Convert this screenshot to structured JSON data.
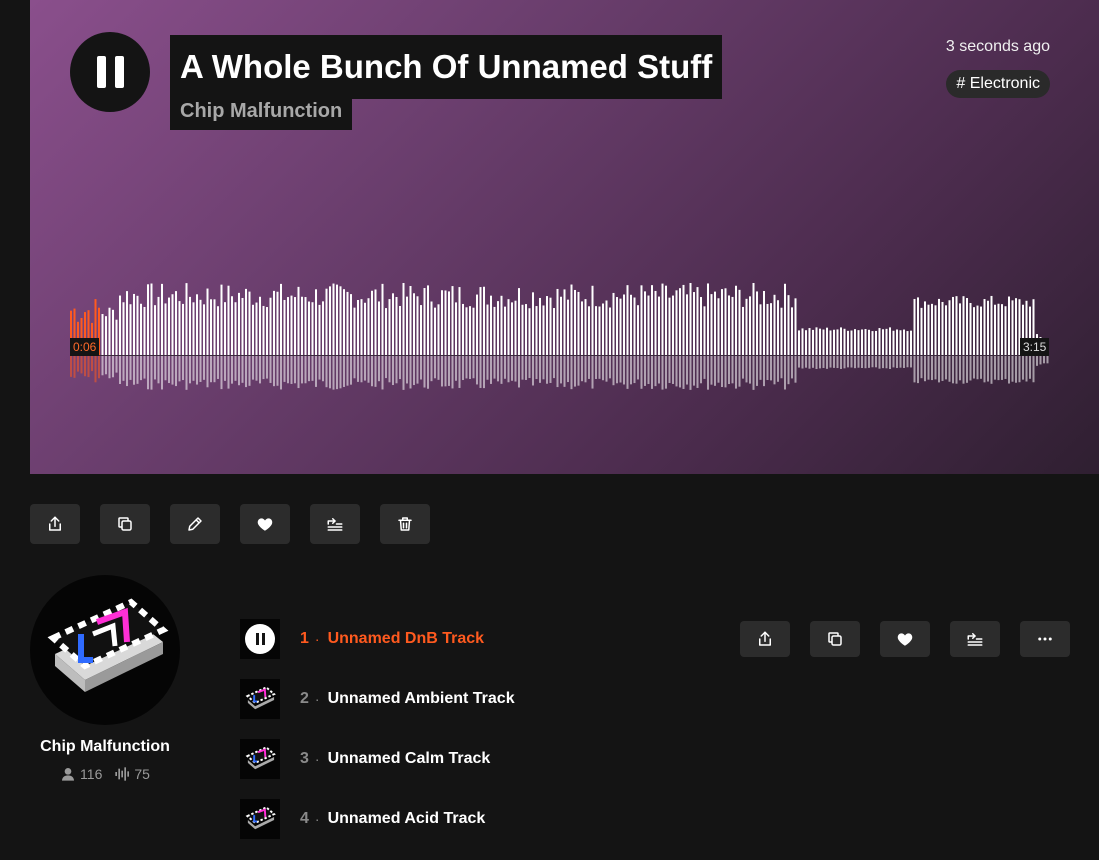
{
  "player": {
    "title": "A Whole Bunch Of Unnamed Stuff",
    "artist": "Chip Malfunction",
    "posted": "3 seconds ago",
    "genre": "# Electronic",
    "current_time": "0:06",
    "total_time": "3:15",
    "progress_fraction": 0.03
  },
  "colors": {
    "accent": "#ff5a1f",
    "wave_played": "#ff5a1f",
    "wave_unplayed": "#ffffff"
  },
  "actions": [
    {
      "name": "share-button",
      "icon": "share-icon"
    },
    {
      "name": "duplicate-button",
      "icon": "copy-icon"
    },
    {
      "name": "edit-button",
      "icon": "pencil-icon"
    },
    {
      "name": "like-button",
      "icon": "heart-icon"
    },
    {
      "name": "add-to-queue-button",
      "icon": "queue-icon"
    },
    {
      "name": "delete-button",
      "icon": "trash-icon"
    }
  ],
  "profile": {
    "name": "Chip Malfunction",
    "followers": "116",
    "tracks": "75"
  },
  "tracks": [
    {
      "num": "1",
      "sep": "·",
      "title": "Unnamed DnB Track",
      "playing": true
    },
    {
      "num": "2",
      "sep": "·",
      "title": "Unnamed Ambient Track",
      "playing": false
    },
    {
      "num": "3",
      "sep": "·",
      "title": "Unnamed Calm Track",
      "playing": false
    },
    {
      "num": "4",
      "sep": "·",
      "title": "Unnamed Acid Track",
      "playing": false
    }
  ],
  "track_actions": [
    {
      "name": "track-share-button",
      "icon": "share-icon"
    },
    {
      "name": "track-duplicate-button",
      "icon": "copy-icon"
    },
    {
      "name": "track-like-button",
      "icon": "heart-icon"
    },
    {
      "name": "track-queue-button",
      "icon": "queue-icon"
    },
    {
      "name": "track-more-button",
      "icon": "more-icon"
    }
  ]
}
